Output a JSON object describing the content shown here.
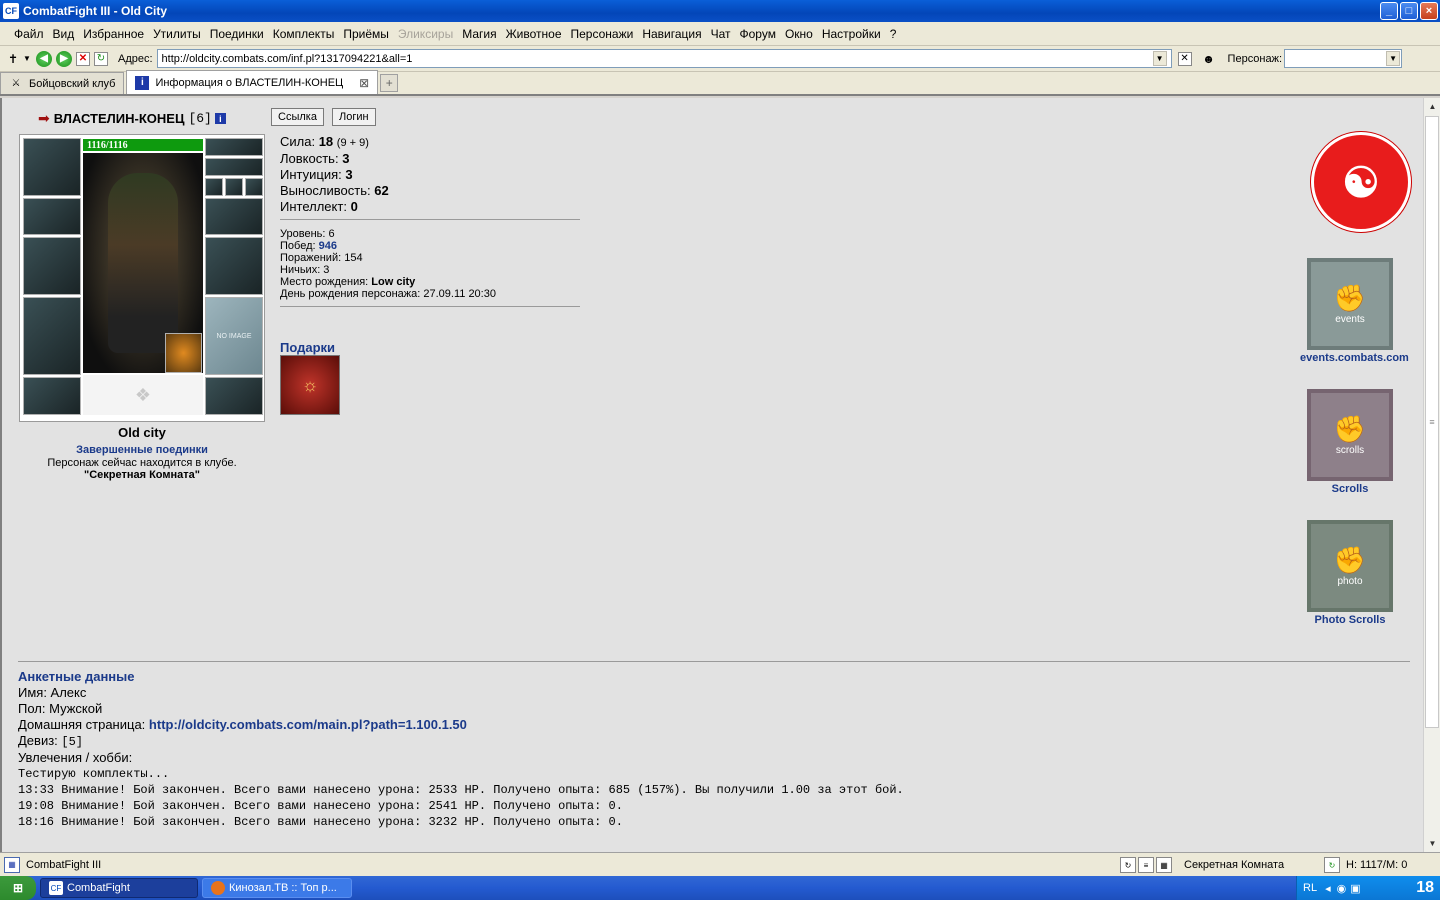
{
  "window": {
    "title": "CombatFight III - Old City",
    "app_badge": "CF",
    "min": "_",
    "max": "□",
    "close": "×"
  },
  "menu": [
    "Файл",
    "Вид",
    "Избранное",
    "Утилиты",
    "Поединки",
    "Комплекты",
    "Приёмы",
    "Эликсиры",
    "Магия",
    "Животное",
    "Персонажи",
    "Навигация",
    "Чат",
    "Форум",
    "Окно",
    "Настройки",
    "?"
  ],
  "menu_disabled_index": 7,
  "address": {
    "label": "Адрес:",
    "url": "http://oldcity.combats.com/inf.pl?1317094221&all=1",
    "person_label": "Персонаж:"
  },
  "tabs": [
    {
      "label": "Бойцовский клуб"
    },
    {
      "label": "Информация о ВЛАСТЕЛИН-КОНЕЦ"
    }
  ],
  "character": {
    "name": "ВЛАСТЕЛИН-КОНЕЦ",
    "level": "[6]",
    "link_button": "Ссылка",
    "login_button": "Логин",
    "hp": "1116/1116",
    "no_image": "NO IMAGE",
    "location": "Old city",
    "finished_fights": "Завершенные поединки",
    "in_club": "Персонаж сейчас находится в клубе.",
    "room": "\"Секретная Комната\""
  },
  "stats": [
    {
      "label": "Сила:",
      "value": "18",
      "extra": "(9 + 9)"
    },
    {
      "label": "Ловкость:",
      "value": "3",
      "extra": ""
    },
    {
      "label": "Интуиция:",
      "value": "3",
      "extra": ""
    },
    {
      "label": "Выносливость:",
      "value": "62",
      "extra": ""
    },
    {
      "label": "Интеллект:",
      "value": "0",
      "extra": ""
    }
  ],
  "info": {
    "level": "Уровень: 6",
    "wins_label": "Побед:",
    "wins": "946",
    "losses": "Поражений: 154",
    "draws": "Ничьих: 3",
    "birthplace_label": "Место рождения:",
    "birthplace": "Low city",
    "birthday": "День рождения персонажа: 27.09.11 20:30"
  },
  "gifts_title": "Подарки",
  "banners": [
    {
      "flag": "events",
      "caption": "events.combats.com"
    },
    {
      "flag": "scrolls",
      "caption": "Scrolls"
    },
    {
      "flag": "photo",
      "caption": "Photo Scrolls"
    }
  ],
  "profile": {
    "title": "Анкетные данные",
    "name": "Имя: Алекс",
    "gender": "Пол: Мужской",
    "homepage_label": "Домашняя страница:",
    "homepage": "http://oldcity.combats.com/main.pl?path=1.100.1.50",
    "motto_label": "Девиз:",
    "motto": "[5]",
    "hobby": "Увлечения / хобби:",
    "lines": [
      "Тестирую комплекты...",
      "13:33 Внимание! Бой закончен. Всего вами нанесено урона: 2533 HP. Получено опыта: 685 (157%). Вы получили 1.00 за этот бой.",
      "19:08 Внимание! Бой закончен. Всего вами нанесено урона: 2541 HP. Получено опыта: 0.",
      "18:16 Внимание! Бой закончен. Всего вами нанесено урона: 3232 HP. Получено опыта: 0."
    ]
  },
  "statusbar": {
    "left": "CombatFight III",
    "room": "Секретная Комната",
    "hp": "Н: 1117/М: 0"
  },
  "taskbar": {
    "tasks": [
      "CombatFight",
      "Кинозал.ТВ :: Топ р..."
    ],
    "lang": "RL",
    "clock": "18"
  }
}
